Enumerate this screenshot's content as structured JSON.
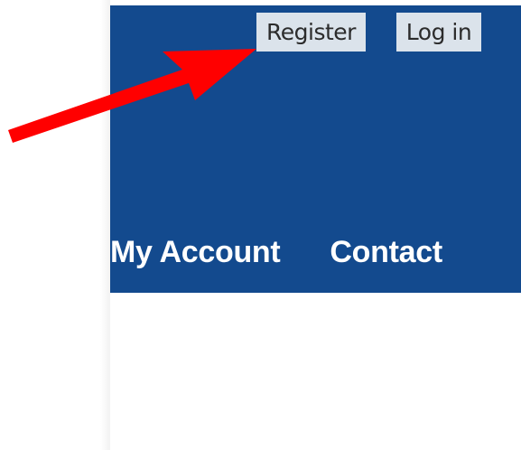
{
  "header": {
    "background_color": "#134a8e",
    "auth": {
      "register_label": "Register",
      "login_label": "Log in"
    },
    "nav": {
      "items": [
        {
          "label": "My Account"
        },
        {
          "label": "Contact"
        }
      ]
    }
  },
  "annotation": {
    "arrow_color": "#ff0000"
  }
}
